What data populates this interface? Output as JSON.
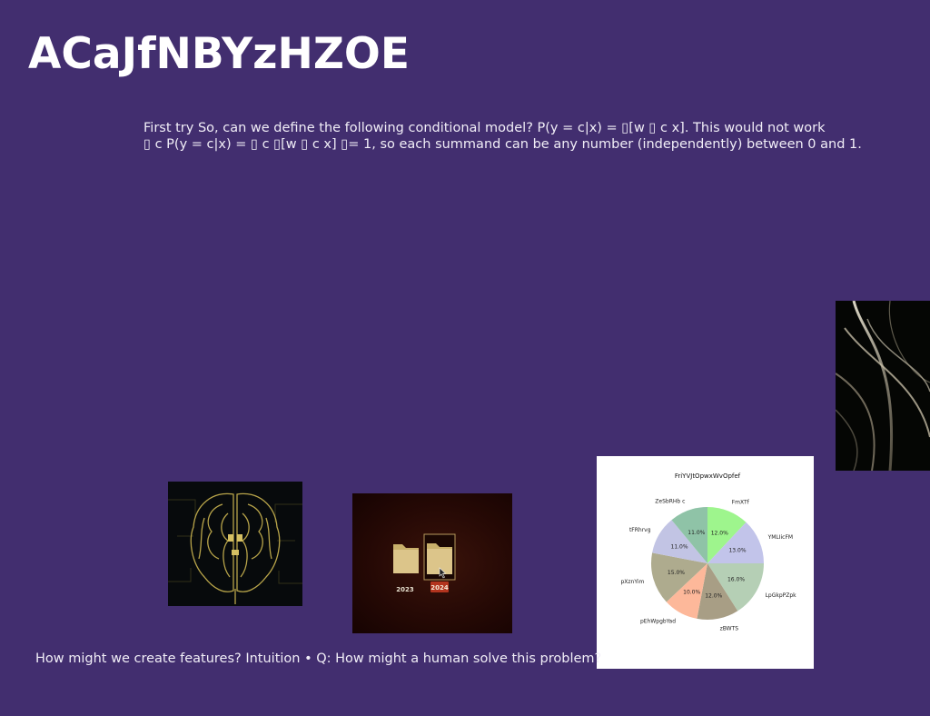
{
  "slide": {
    "title": "ACaJfNBYzHZOE",
    "body_lines": [
      "First try So, can we define the following conditional model? P(y = c|x) = ▯[w ▯ c x]. This would not work",
      "▯ c P(y = c|x) = ▯ c ▯[w ▯ c x] ▯= 1, so each summand can be any number (independently) between 0 and 1."
    ],
    "caption": "How might we create features? Intuition • Q: How might a human solve this problem?"
  },
  "images": {
    "brain": {
      "icon": "circuit-brain-image"
    },
    "folders": {
      "icon": "folders-image",
      "labels": [
        "2023",
        "2024"
      ]
    },
    "abstract": {
      "icon": "abstract-swirl-image"
    }
  },
  "chart_data": {
    "type": "pie",
    "title": "FriYVJtOpwxWvOpfef",
    "categories": [
      "FmXTf",
      "YMLIicFM",
      "LpGkpPZpk",
      "zBWTS",
      "pEhWpgbYad",
      "pXznYim",
      "tFRhrvg",
      "ZeSbRHb c"
    ],
    "values": [
      12.0,
      13.0,
      16.0,
      12.0,
      10.0,
      15.0,
      11.0,
      11.0
    ],
    "percent_labels": [
      "12.0%",
      "13.0%",
      "16.0%",
      "12.0%",
      "10.0%",
      "15.0%",
      "11.0%",
      "11.0%"
    ],
    "colors": [
      "#9ef58d",
      "#c2c4ea",
      "#b5cfb5",
      "#a89e85",
      "#fdb89a",
      "#aeab8e",
      "#c2c4e4",
      "#8fc3a7"
    ],
    "start_angle_deg": 90,
    "direction": "clockwise"
  }
}
